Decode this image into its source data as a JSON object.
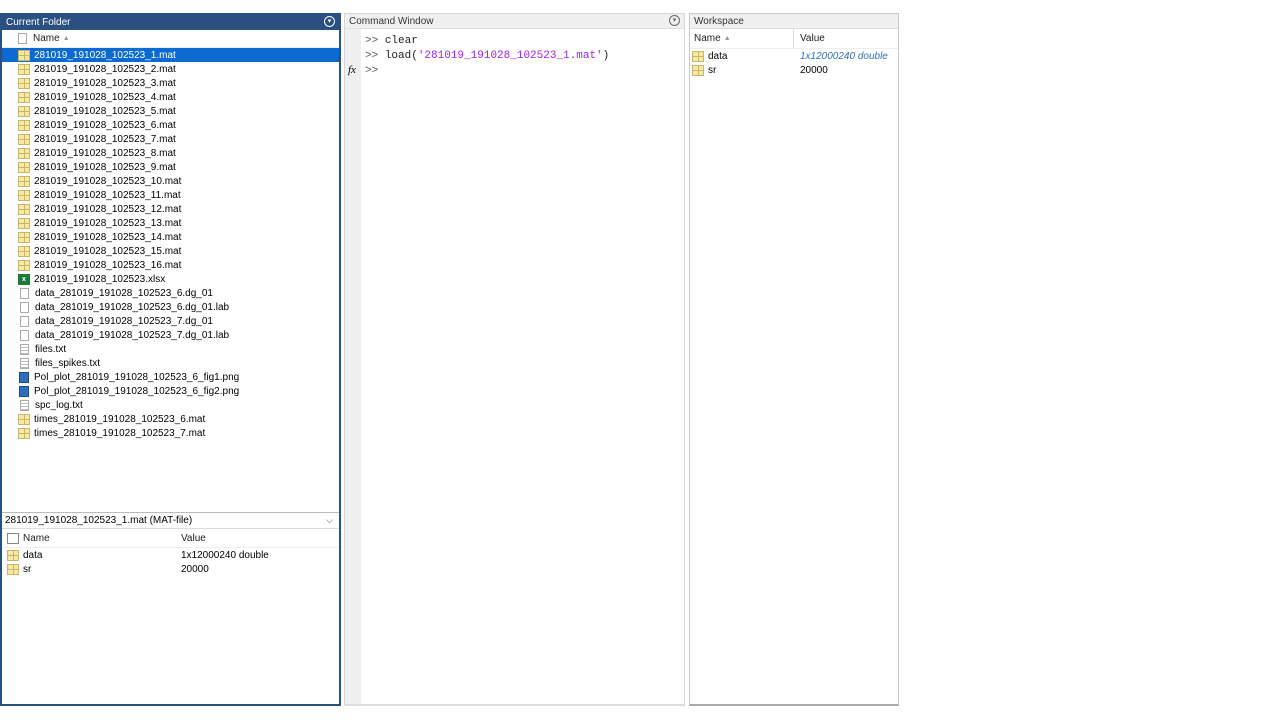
{
  "current_folder": {
    "title": "Current Folder",
    "column_name": "Name",
    "files": [
      {
        "name": "281019_191028_102523_1.mat",
        "type": "mat",
        "selected": true
      },
      {
        "name": "281019_191028_102523_2.mat",
        "type": "mat"
      },
      {
        "name": "281019_191028_102523_3.mat",
        "type": "mat"
      },
      {
        "name": "281019_191028_102523_4.mat",
        "type": "mat"
      },
      {
        "name": "281019_191028_102523_5.mat",
        "type": "mat"
      },
      {
        "name": "281019_191028_102523_6.mat",
        "type": "mat"
      },
      {
        "name": "281019_191028_102523_7.mat",
        "type": "mat"
      },
      {
        "name": "281019_191028_102523_8.mat",
        "type": "mat"
      },
      {
        "name": "281019_191028_102523_9.mat",
        "type": "mat"
      },
      {
        "name": "281019_191028_102523_10.mat",
        "type": "mat"
      },
      {
        "name": "281019_191028_102523_11.mat",
        "type": "mat"
      },
      {
        "name": "281019_191028_102523_12.mat",
        "type": "mat"
      },
      {
        "name": "281019_191028_102523_13.mat",
        "type": "mat"
      },
      {
        "name": "281019_191028_102523_14.mat",
        "type": "mat"
      },
      {
        "name": "281019_191028_102523_15.mat",
        "type": "mat"
      },
      {
        "name": "281019_191028_102523_16.mat",
        "type": "mat"
      },
      {
        "name": "281019_191028_102523.xlsx",
        "type": "xls"
      },
      {
        "name": "data_281019_191028_102523_6.dg_01",
        "type": "txt"
      },
      {
        "name": "data_281019_191028_102523_6.dg_01.lab",
        "type": "txt"
      },
      {
        "name": "data_281019_191028_102523_7.dg_01",
        "type": "txt"
      },
      {
        "name": "data_281019_191028_102523_7.dg_01.lab",
        "type": "txt"
      },
      {
        "name": "files.txt",
        "type": "txtl"
      },
      {
        "name": "files_spikes.txt",
        "type": "txtl"
      },
      {
        "name": "Pol_plot_281019_191028_102523_6_fig1.png",
        "type": "png"
      },
      {
        "name": "Pol_plot_281019_191028_102523_6_fig2.png",
        "type": "png"
      },
      {
        "name": "spc_log.txt",
        "type": "txtl"
      },
      {
        "name": "times_281019_191028_102523_6.mat",
        "type": "mat"
      },
      {
        "name": "times_281019_191028_102523_7.mat",
        "type": "mat"
      }
    ],
    "detail": {
      "title": "281019_191028_102523_1.mat  (MAT-file)",
      "col_name": "Name",
      "col_value": "Value",
      "vars": [
        {
          "name": "data",
          "value": "1x12000240 double"
        },
        {
          "name": "sr",
          "value": "20000"
        }
      ]
    }
  },
  "command_window": {
    "title": "Command Window",
    "prompt": ">>",
    "line1_cmd": "clear",
    "line2_fn": "load(",
    "line2_str": "'281019_191028_102523_1.mat'",
    "line2_end": ")",
    "fx": "fx"
  },
  "workspace": {
    "title": "Workspace",
    "col_name": "Name",
    "col_value": "Value",
    "vars": [
      {
        "name": "data",
        "value": "1x12000240 double"
      },
      {
        "name": "sr",
        "value": "20000"
      }
    ]
  }
}
